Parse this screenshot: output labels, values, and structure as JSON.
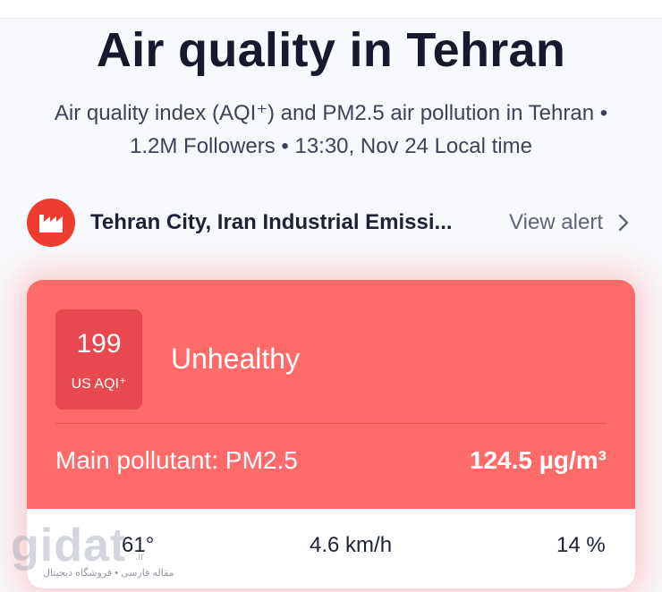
{
  "header": {
    "title": "Air quality in Tehran",
    "subtitle_line1": "Air quality index (AQI⁺) and PM2.5 air pollution in Tehran •",
    "subtitle_line2": "1.2M Followers • 13:30, Nov 24 Local time"
  },
  "alert": {
    "text": "Tehran City, Iran Industrial Emissi...",
    "link_label": "View alert",
    "icon": "factory-icon",
    "icon_color": "#ee3d2f"
  },
  "aqi_card": {
    "value": "199",
    "unit": "US AQI⁺",
    "status": "Unhealthy",
    "pollutant_label": "Main pollutant: PM2.5",
    "concentration": "124.5 µg/m³",
    "card_color": "#ff6a6a",
    "box_color": "#e8484f"
  },
  "weather": {
    "temperature": "61°",
    "wind": "4.6 km/h",
    "humidity": "14 %"
  },
  "watermark": {
    "main": "gidat",
    "suffix": ".ir",
    "tagline": "مقاله فارسی • فروشگاه دیجیتال"
  }
}
